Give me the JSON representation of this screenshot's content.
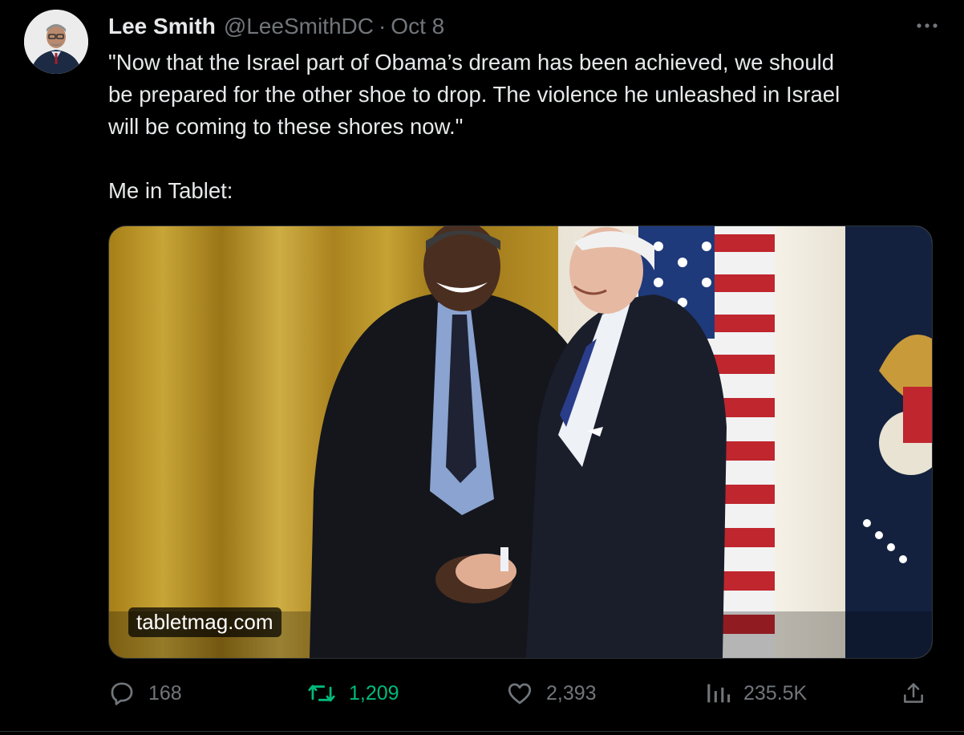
{
  "tweet": {
    "author_name": "Lee Smith",
    "author_handle": "@LeeSmithDC",
    "separator": "·",
    "timestamp": "Oct 8",
    "text": "\"Now that the Israel part of Obama’s dream has been achieved, we should\nbe prepared for the other shoe to drop. The violence he unleashed in Israel\nwill be coming to these shores now.\"\n\nMe in Tablet:",
    "card_domain": "tabletmag.com"
  },
  "actions": {
    "reply_count": "168",
    "retweet_count": "1,209",
    "like_count": "2,393",
    "view_count": "235.5K"
  },
  "icons": {
    "more": "more-dots-icon",
    "reply": "reply-icon",
    "retweet": "retweet-icon",
    "like": "heart-icon",
    "views": "views-icon",
    "share": "share-icon"
  },
  "colors": {
    "background": "#000000",
    "text": "#e7e9ea",
    "muted": "#71767b",
    "retweet_active": "#00ba7c"
  }
}
